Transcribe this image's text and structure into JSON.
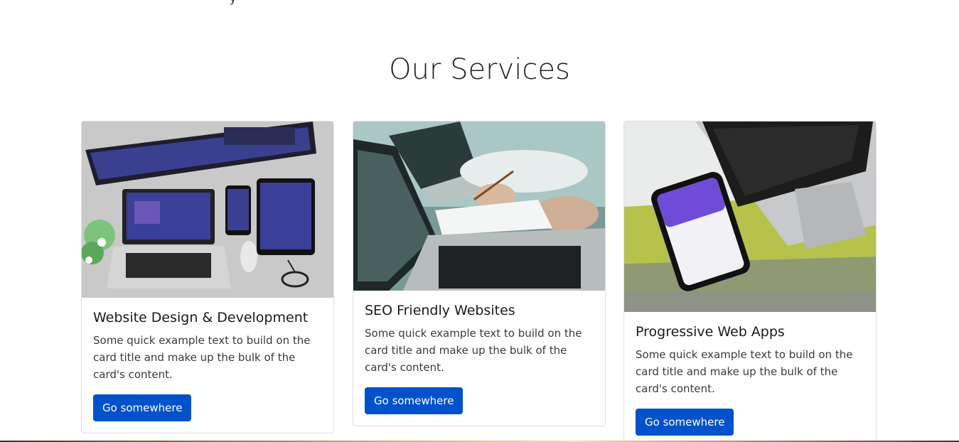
{
  "section": {
    "title": "Our Services"
  },
  "cards": [
    {
      "title": "Website Design & Development",
      "text": "Some quick example text to build on the card title and make up the bulk of the card's content.",
      "button": "Go somewhere",
      "image_icon": "devices-mockup-image"
    },
    {
      "title": "SEO Friendly Websites",
      "text": "Some quick example text to build on the card title and make up the bulk of the card's content.",
      "button": "Go somewhere",
      "image_icon": "laptop-meeting-image"
    },
    {
      "title": "Progressive Web Apps",
      "text": "Some quick example text to build on the card title and make up the bulk of the card's content.",
      "button": "Go somewhere",
      "image_icon": "phone-laptop-image"
    }
  ],
  "colors": {
    "button": "#0052cc",
    "title": "#212529",
    "border": "rgba(0,0,0,0.125)"
  }
}
